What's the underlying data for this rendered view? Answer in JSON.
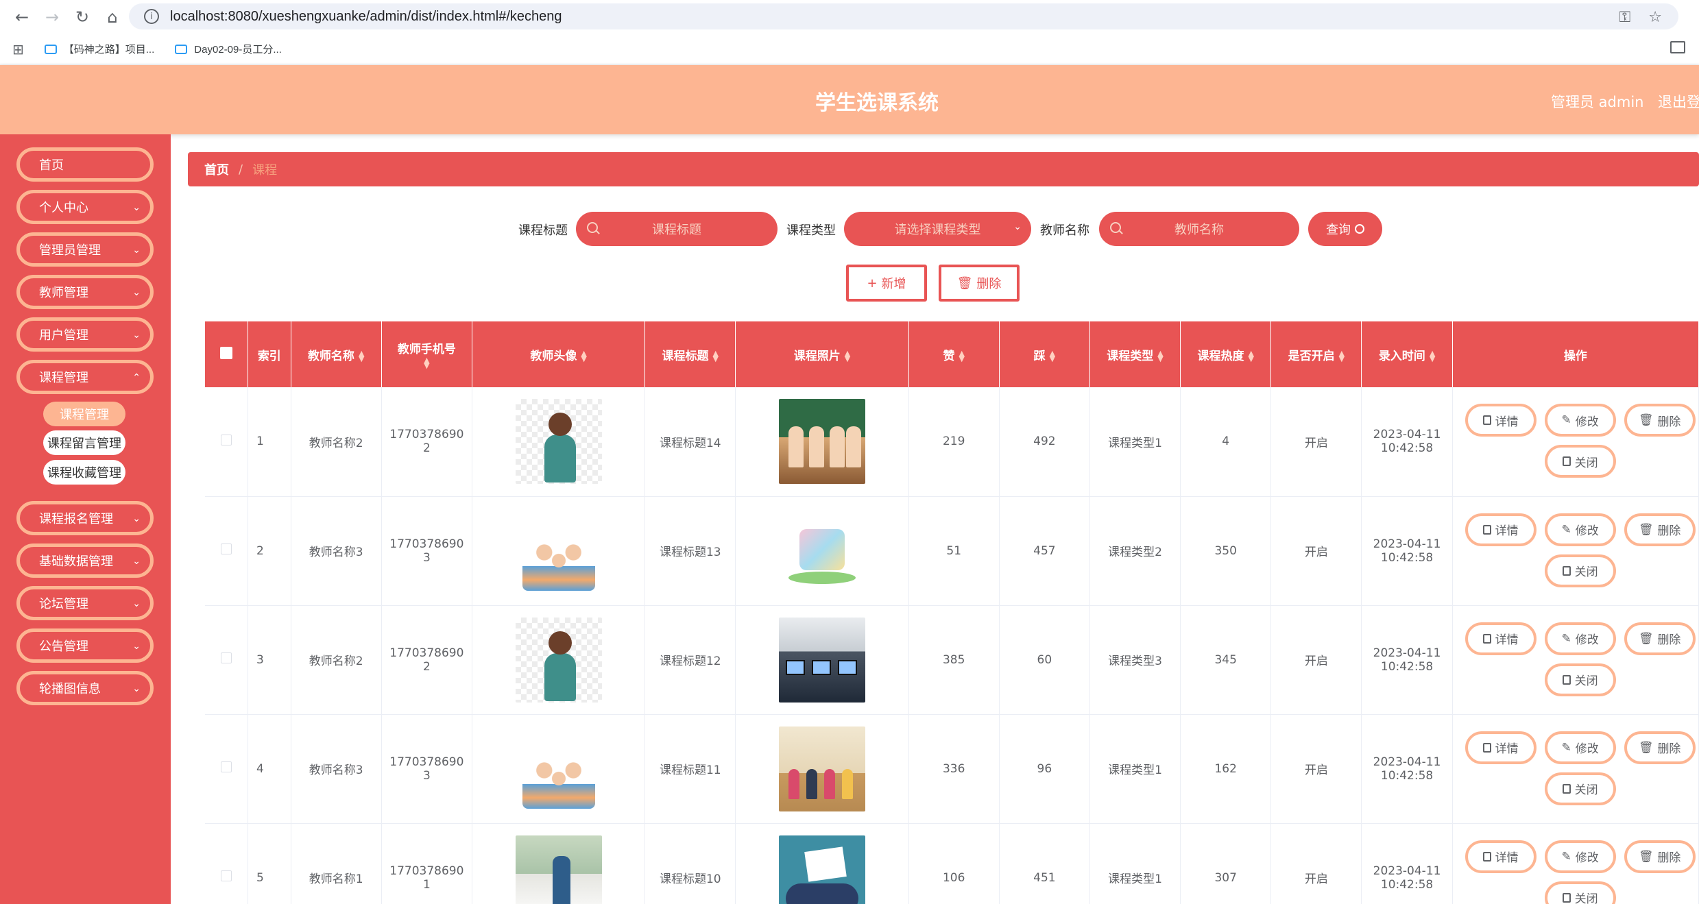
{
  "browser": {
    "url": "localhost:8080/xueshengxuanke/admin/dist/index.html#/kecheng",
    "bookmarks": [
      "【码神之路】项目...",
      "Day02-09-员工分..."
    ]
  },
  "header": {
    "title": "学生选课系统",
    "user": "管理员 admin",
    "logout": "退出登"
  },
  "sidebar": {
    "items": [
      "首页",
      "个人中心",
      "管理员管理",
      "教师管理",
      "用户管理",
      "课程管理",
      "课程报名管理",
      "基础数据管理",
      "论坛管理",
      "公告管理",
      "轮播图信息"
    ],
    "sub_items": [
      "课程管理",
      "课程留言管理",
      "课程收藏管理"
    ]
  },
  "breadcrumb": {
    "home": "首页",
    "separator": "/",
    "current": "课程"
  },
  "search": {
    "title_label": "课程标题",
    "title_placeholder": "课程标题",
    "type_label": "课程类型",
    "type_placeholder": "请选择课程类型",
    "teacher_label": "教师名称",
    "teacher_placeholder": "教师名称",
    "query_button": "查询"
  },
  "actions": {
    "add": "新增",
    "delete": "删除"
  },
  "table": {
    "columns": [
      "索引",
      "教师名称",
      "教师手机号",
      "教师头像",
      "课程标题",
      "课程照片",
      "赞",
      "踩",
      "课程类型",
      "课程热度",
      "是否开启",
      "录入时间",
      "操作"
    ],
    "ops": [
      "详情",
      "修改",
      "删除",
      "关闭"
    ],
    "rows": [
      {
        "index": "1",
        "teacher": "教师名称2",
        "phone_a": "1770378690",
        "phone_b": "2",
        "title": "课程标题14",
        "likes": "219",
        "dislikes": "492",
        "type": "课程类型1",
        "heat": "4",
        "open": "开启",
        "date": "2023-04-11",
        "time": "10:42:58"
      },
      {
        "index": "2",
        "teacher": "教师名称3",
        "phone_a": "1770378690",
        "phone_b": "3",
        "title": "课程标题13",
        "likes": "51",
        "dislikes": "457",
        "type": "课程类型2",
        "heat": "350",
        "open": "开启",
        "date": "2023-04-11",
        "time": "10:42:58"
      },
      {
        "index": "3",
        "teacher": "教师名称2",
        "phone_a": "1770378690",
        "phone_b": "2",
        "title": "课程标题12",
        "likes": "385",
        "dislikes": "60",
        "type": "课程类型3",
        "heat": "345",
        "open": "开启",
        "date": "2023-04-11",
        "time": "10:42:58"
      },
      {
        "index": "4",
        "teacher": "教师名称3",
        "phone_a": "1770378690",
        "phone_b": "3",
        "title": "课程标题11",
        "likes": "336",
        "dislikes": "96",
        "type": "课程类型1",
        "heat": "162",
        "open": "开启",
        "date": "2023-04-11",
        "time": "10:42:58"
      },
      {
        "index": "5",
        "teacher": "教师名称1",
        "phone_a": "1770378690",
        "phone_b": "1",
        "title": "课程标题10",
        "likes": "106",
        "dislikes": "451",
        "type": "课程类型1",
        "heat": "307",
        "open": "开启",
        "date": "2023-04-11",
        "time": "10:42:58"
      }
    ]
  }
}
